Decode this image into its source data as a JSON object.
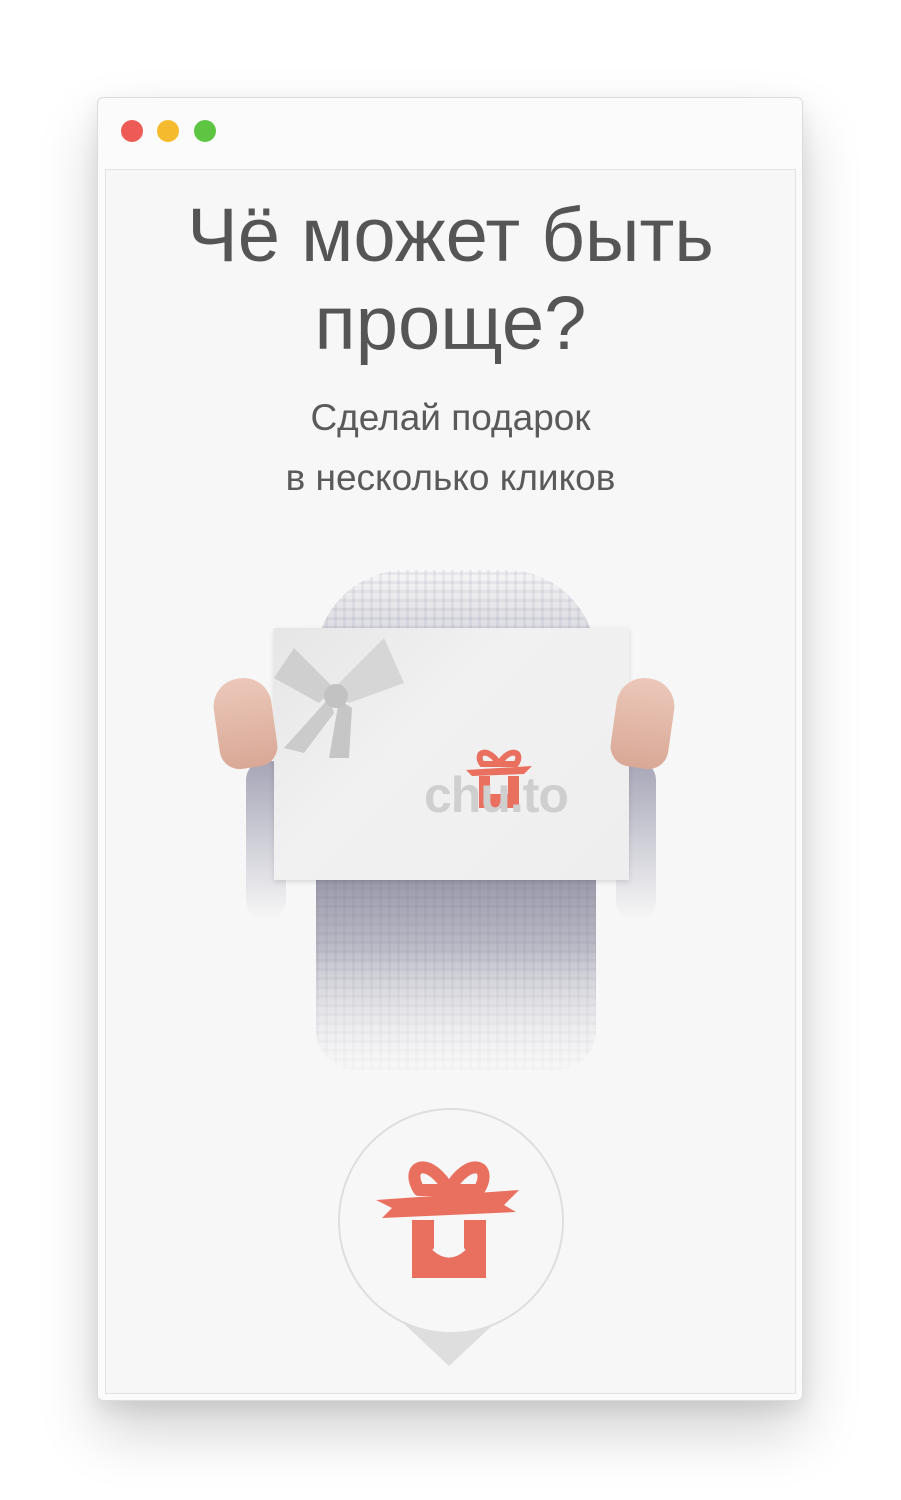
{
  "window": {
    "buttons": [
      {
        "name": "close",
        "color": "#ee5b56"
      },
      {
        "name": "minimize",
        "color": "#f5bb2e"
      },
      {
        "name": "maximize",
        "color": "#5ec543"
      }
    ]
  },
  "page": {
    "headline_line1": "Чё может быть",
    "headline_line2": "проще?",
    "subtitle_line1": "Сделай подарок",
    "subtitle_line2": "в несколько кликов",
    "card_logo": "chu.to",
    "accent_color": "#e9705f",
    "icons": [
      "gift-icon",
      "ribbon-bow-icon",
      "pin-gift-icon"
    ]
  }
}
